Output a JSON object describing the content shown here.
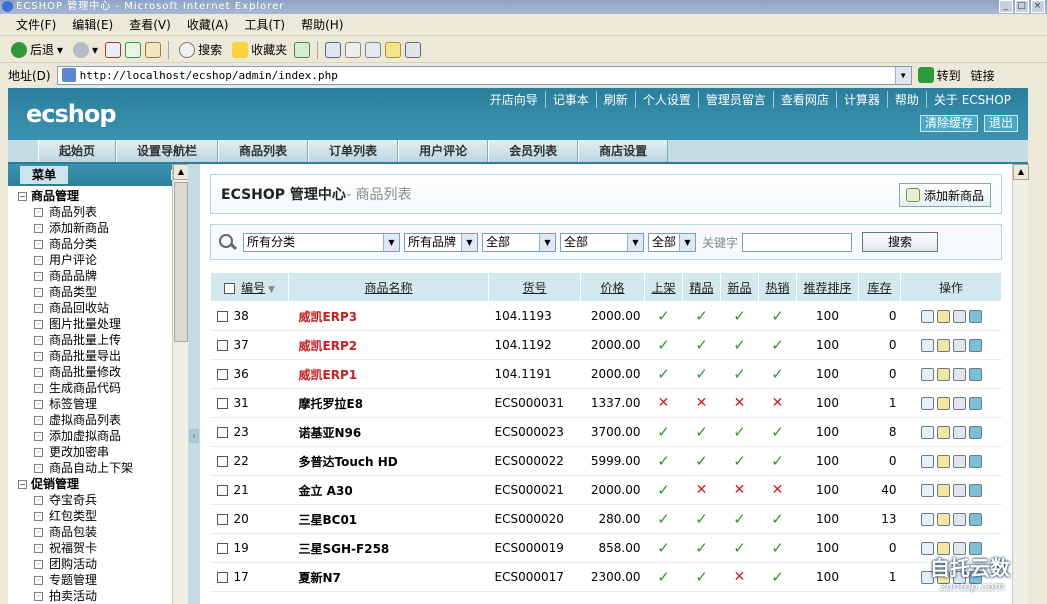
{
  "window": {
    "title": "ECSHOP 管理中心 - Microsoft Internet Explorer"
  },
  "menu": [
    "文件(F)",
    "编辑(E)",
    "查看(V)",
    "收藏(A)",
    "工具(T)",
    "帮助(H)"
  ],
  "toolbar": {
    "back": "后退",
    "search": "搜索",
    "favorites": "收藏夹"
  },
  "address": {
    "label": "地址(D)",
    "url": "http://localhost/ecshop/admin/index.php",
    "go": "转到",
    "links": "链接"
  },
  "header": {
    "logo": "ecshop",
    "nav": [
      "开店向导",
      "记事本",
      "刷新",
      "个人设置",
      "管理员留言",
      "查看网店",
      "计算器",
      "帮助",
      "关于 ECSHOP"
    ],
    "buttons": [
      "清除缓存",
      "退出"
    ]
  },
  "mainnav": [
    "起始页",
    "设置导航栏",
    "商品列表",
    "订单列表",
    "用户评论",
    "会员列表",
    "商店设置"
  ],
  "sidebar": {
    "title": "菜单",
    "groups": [
      {
        "name": "商品管理",
        "items": [
          "商品列表",
          "添加新商品",
          "商品分类",
          "用户评论",
          "商品品牌",
          "商品类型",
          "商品回收站",
          "图片批量处理",
          "商品批量上传",
          "商品批量导出",
          "商品批量修改",
          "生成商品代码",
          "标签管理",
          "虚拟商品列表",
          "添加虚拟商品",
          "更改加密串",
          "商品自动上下架"
        ]
      },
      {
        "name": "促销管理",
        "items": [
          "夺宝奇兵",
          "红包类型",
          "商品包装",
          "祝福贺卡",
          "团购活动",
          "专题管理",
          "拍卖活动"
        ]
      }
    ]
  },
  "content": {
    "title": "ECSHOP 管理中心",
    "subtitle": "- 商品列表",
    "add_button": "添加新商品",
    "filters": {
      "category": "所有分类",
      "brand": "所有品牌",
      "f3": "全部",
      "f4": "全部",
      "f5": "全部",
      "keyword_label": "关键字",
      "search": "搜索"
    },
    "columns": [
      "编号",
      "商品名称",
      "货号",
      "价格",
      "上架",
      "精品",
      "新品",
      "热销",
      "推荐排序",
      "库存",
      "操作"
    ],
    "rows": [
      {
        "id": "38",
        "name": "威凯ERP3",
        "sn": "104.1193",
        "price": "2000.00",
        "onsale": "y",
        "best": "y",
        "new": "y",
        "hot": "y",
        "sort": "100",
        "stock": "0",
        "red": true
      },
      {
        "id": "37",
        "name": "威凯ERP2",
        "sn": "104.1192",
        "price": "2000.00",
        "onsale": "y",
        "best": "y",
        "new": "y",
        "hot": "y",
        "sort": "100",
        "stock": "0",
        "red": true
      },
      {
        "id": "36",
        "name": "威凯ERP1",
        "sn": "104.1191",
        "price": "2000.00",
        "onsale": "y",
        "best": "y",
        "new": "y",
        "hot": "y",
        "sort": "100",
        "stock": "0",
        "red": true
      },
      {
        "id": "31",
        "name": "摩托罗拉E8",
        "sn": "ECS000031",
        "price": "1337.00",
        "onsale": "n",
        "best": "n",
        "new": "n",
        "hot": "n",
        "sort": "100",
        "stock": "1",
        "red": false
      },
      {
        "id": "23",
        "name": "诺基亚N96",
        "sn": "ECS000023",
        "price": "3700.00",
        "onsale": "y",
        "best": "y",
        "new": "y",
        "hot": "y",
        "sort": "100",
        "stock": "8",
        "red": false
      },
      {
        "id": "22",
        "name": "多普达Touch HD",
        "sn": "ECS000022",
        "price": "5999.00",
        "onsale": "y",
        "best": "y",
        "new": "y",
        "hot": "y",
        "sort": "100",
        "stock": "0",
        "red": false
      },
      {
        "id": "21",
        "name": "金立 A30",
        "sn": "ECS000021",
        "price": "2000.00",
        "onsale": "y",
        "best": "n",
        "new": "n",
        "hot": "n",
        "sort": "100",
        "stock": "40",
        "red": false
      },
      {
        "id": "20",
        "name": "三星BC01",
        "sn": "ECS000020",
        "price": "280.00",
        "onsale": "y",
        "best": "y",
        "new": "y",
        "hot": "y",
        "sort": "100",
        "stock": "13",
        "red": false
      },
      {
        "id": "19",
        "name": "三星SGH-F258",
        "sn": "ECS000019",
        "price": "858.00",
        "onsale": "y",
        "best": "y",
        "new": "y",
        "hot": "y",
        "sort": "100",
        "stock": "0",
        "red": false
      },
      {
        "id": "17",
        "name": "夏新N7",
        "sn": "ECS000017",
        "price": "2300.00",
        "onsale": "y",
        "best": "y",
        "new": "n",
        "hot": "y",
        "sort": "100",
        "stock": "1",
        "red": false
      }
    ]
  },
  "watermark": {
    "line1": "自托云数",
    "line2": "zuntop.com"
  }
}
